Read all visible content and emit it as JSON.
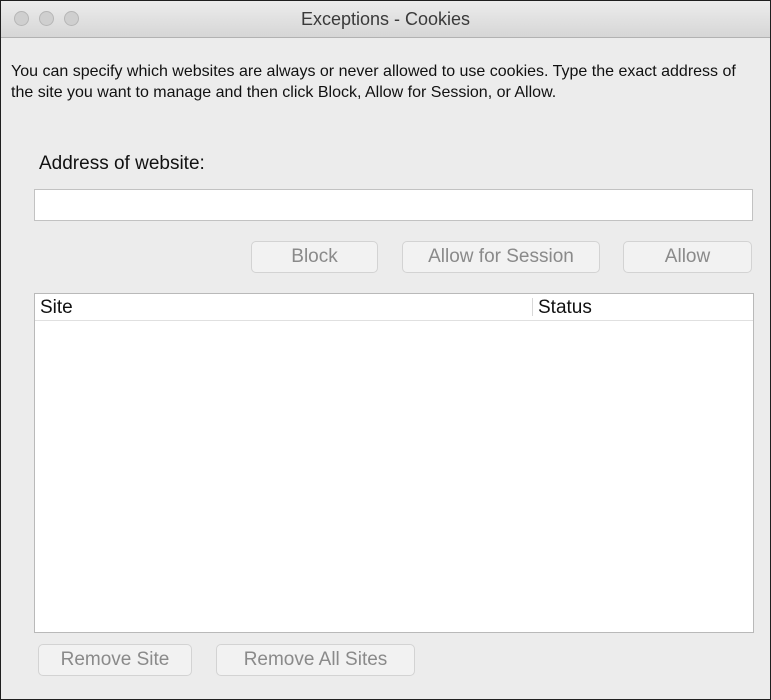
{
  "window": {
    "title": "Exceptions - Cookies"
  },
  "description": "You can specify which websites are always or never allowed to use cookies. Type the exact address of the site you want to manage and then click Block, Allow for Session, or Allow.",
  "address": {
    "label": "Address of website:",
    "value": "",
    "placeholder": ""
  },
  "actions": {
    "block": "Block",
    "allow_session": "Allow for Session",
    "allow": "Allow"
  },
  "table": {
    "columns": [
      "Site",
      "Status"
    ],
    "rows": []
  },
  "footer": {
    "remove_site": "Remove Site",
    "remove_all": "Remove All Sites"
  },
  "icons": {
    "traffic_lights": [
      "close-icon",
      "minimize-icon",
      "zoom-icon"
    ]
  },
  "colors": {
    "window_bg": "#ececec",
    "disabled_text": "#8a8a8a",
    "traffic_light_inactive": "#cfcfcf"
  }
}
